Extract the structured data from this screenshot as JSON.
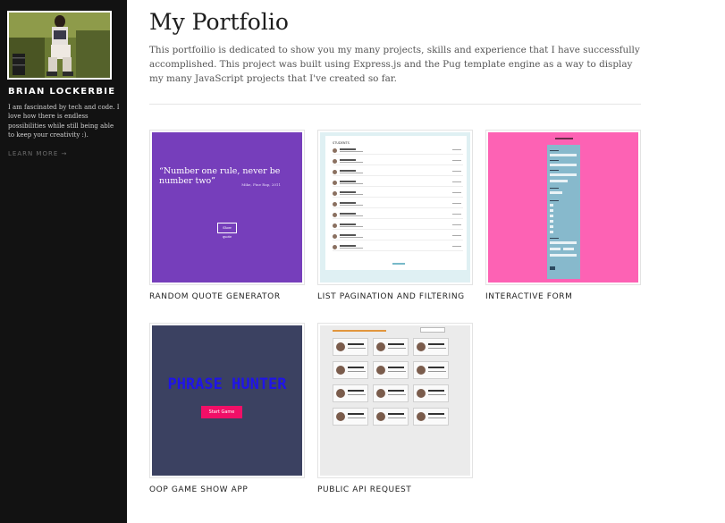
{
  "sidebar": {
    "name": "BRIAN LOCKERBIE",
    "bio": "I am fascinated by tech and code. I love how there is endless possibilities while still being able to keep your creativity :).",
    "learn_more": "LEARN MORE →"
  },
  "main": {
    "title": "My Portfolio",
    "intro": "This portfoilio is dedicated to show you my many projects, skills and experience that I have successfully accomplished. This project was built using Express.js and the Pug template engine as a way to display my many JavaScript projects that I've created so far."
  },
  "projects": [
    {
      "title": "RANDOM QUOTE GENERATOR",
      "thumb": {
        "quote": "“Number one rule, never be number two”",
        "source": "Mike, Fine Rap, 2011",
        "button": "Show quote",
        "bg": "#763ebb"
      }
    },
    {
      "title": "LIST PAGINATION AND FILTERING",
      "thumb": {
        "heading": "STUDENTS",
        "bg": "#dff0f3"
      }
    },
    {
      "title": "INTERACTIVE FORM",
      "thumb": {
        "bg": "#fd62b4"
      }
    },
    {
      "title": "OOP GAME SHOW APP",
      "thumb": {
        "game_title": "PHRASE HUNTER",
        "button": "Start Game",
        "bg": "#3b4161"
      }
    },
    {
      "title": "PUBLIC API REQUEST",
      "thumb": {
        "bg": "#ebebeb"
      }
    }
  ],
  "colors": {
    "sidebar_bg": "#121212",
    "accent_purple": "#763ebb",
    "accent_pink": "#fd62b4",
    "accent_navy": "#3b4161"
  }
}
